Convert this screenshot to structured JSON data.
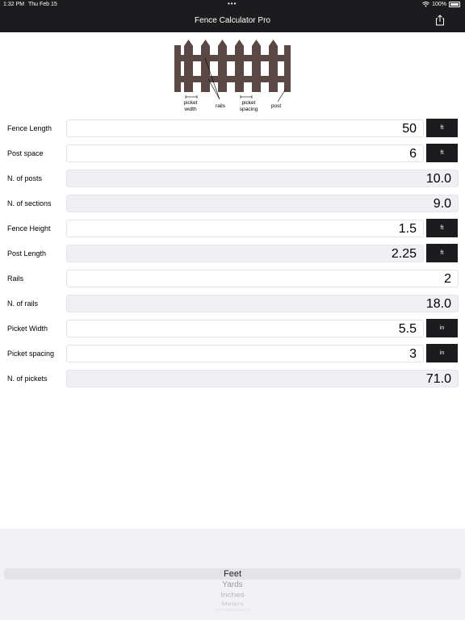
{
  "status": {
    "time": "1:32 PM",
    "date": "Thu Feb 15",
    "dots": "•••",
    "battery": "100%"
  },
  "nav": {
    "title": "Fence Calculator Pro"
  },
  "diagram": {
    "labels": {
      "picket_width": "picket\nwidth",
      "rails": "rails",
      "picket_spacing": "picket\nspacing",
      "post": "post"
    },
    "colors": {
      "wood": "#5a4845",
      "pointer": "#000000"
    }
  },
  "rows": [
    {
      "label": "Fence Length",
      "value": "50",
      "unit": "ft",
      "computed": false
    },
    {
      "label": "Post space",
      "value": "6",
      "unit": "ft",
      "computed": false
    },
    {
      "label": "N. of posts",
      "value": "10.0",
      "unit": "",
      "computed": true
    },
    {
      "label": "N. of sections",
      "value": "9.0",
      "unit": "",
      "computed": true
    },
    {
      "label": "Fence Height",
      "value": "1.5",
      "unit": "ft",
      "computed": false
    },
    {
      "label": "Post Length",
      "value": "2.25",
      "unit": "ft",
      "computed": true
    },
    {
      "label": "Rails",
      "value": "2",
      "unit": "",
      "computed": false
    },
    {
      "label": "N. of rails",
      "value": "18.0",
      "unit": "",
      "computed": true
    },
    {
      "label": "Picket Width",
      "value": "5.5",
      "unit": "in",
      "computed": false
    },
    {
      "label": "Picket spacing",
      "value": "3",
      "unit": "in",
      "computed": false
    },
    {
      "label": "N. of pickets",
      "value": "71.0",
      "unit": "",
      "computed": true
    }
  ],
  "picker": {
    "selected": "Feet",
    "options": [
      "Feet",
      "Yards",
      "Inches",
      "Meters",
      "Centimeters"
    ]
  },
  "theme": {
    "bar": "#1c1c1e",
    "field_computed": "#efeff4",
    "unit_button": "#1c1c1e"
  }
}
